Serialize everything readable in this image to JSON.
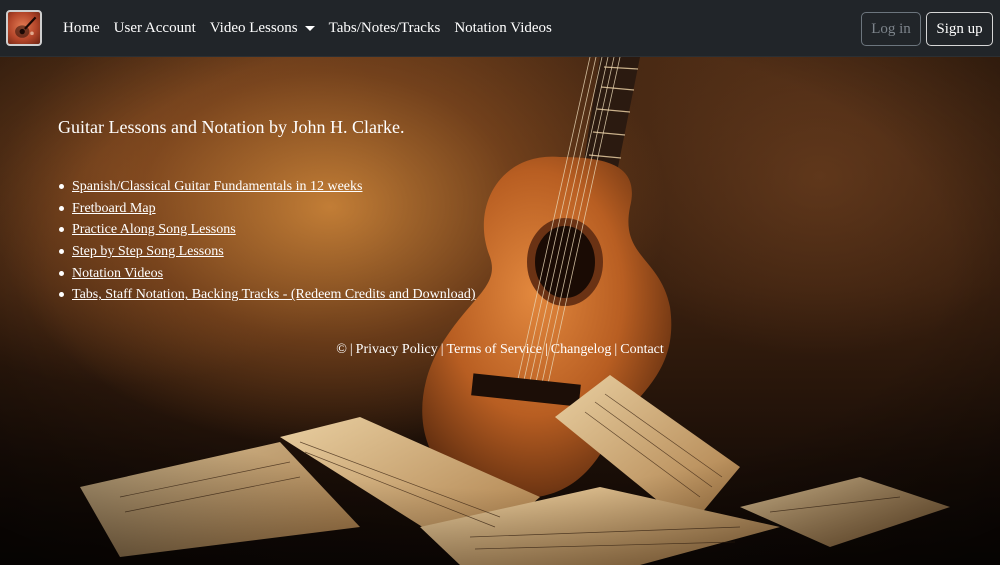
{
  "navbar": {
    "logo_icon": "guitar-logo-icon",
    "links": [
      {
        "label": "Home"
      },
      {
        "label": "User Account"
      },
      {
        "label": "Video Lessons",
        "has_dropdown": true
      },
      {
        "label": "Tabs/Notes/Tracks"
      },
      {
        "label": "Notation Videos"
      }
    ],
    "login_label": "Log in",
    "signup_label": "Sign up"
  },
  "main": {
    "heading": "Guitar Lessons and Notation by John H. Clarke.",
    "lessons": [
      {
        "label": "Spanish/Classical Guitar Fundamentals in 12 weeks"
      },
      {
        "label": "Fretboard Map"
      },
      {
        "label": "Practice Along Song Lessons"
      },
      {
        "label": "Step by Step Song Lessons"
      },
      {
        "label": "Notation Videos"
      },
      {
        "label": "Tabs, Staff Notation, Backing Tracks - (Redeem Credits and Download)"
      }
    ]
  },
  "footer": {
    "copyright": "©",
    "links": [
      {
        "label": "Privacy Policy"
      },
      {
        "label": "Terms of Service"
      },
      {
        "label": "Changelog"
      },
      {
        "label": "Contact"
      }
    ]
  },
  "colors": {
    "navbar_bg": "#212529",
    "hero_tone": "#8a4f22"
  }
}
